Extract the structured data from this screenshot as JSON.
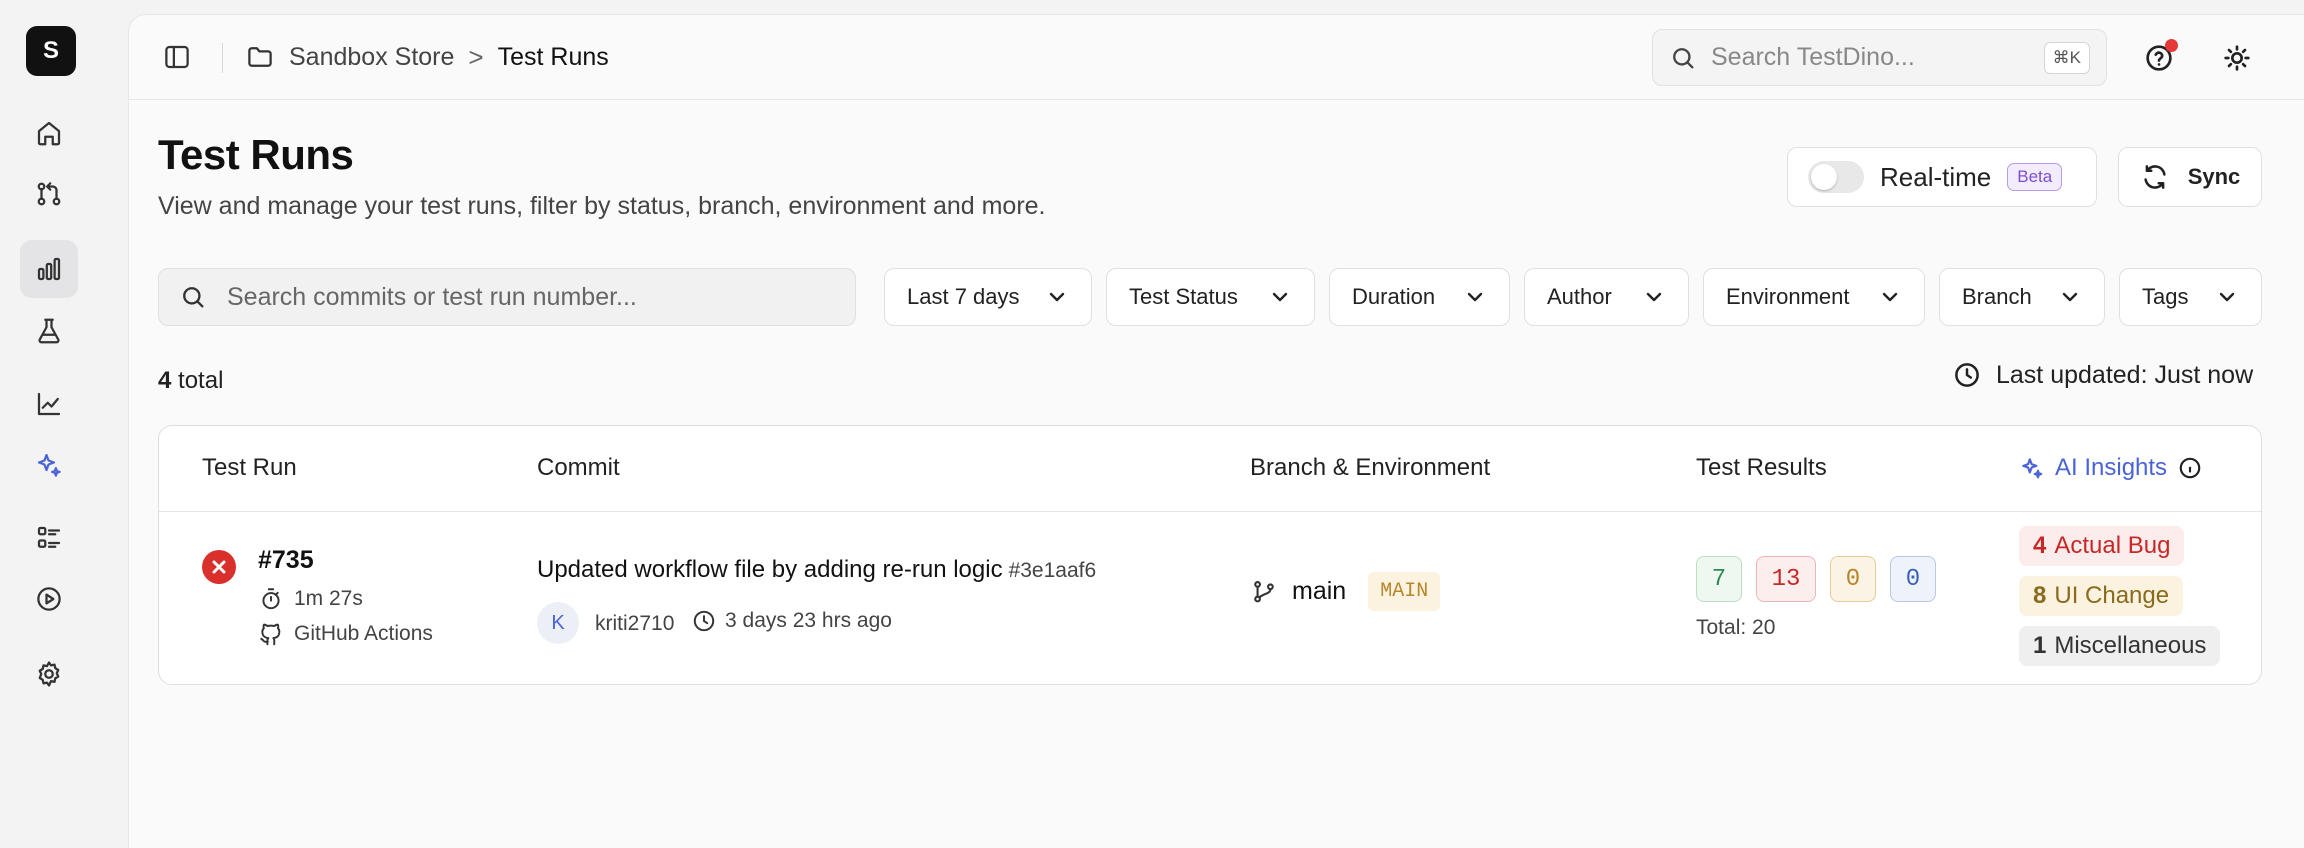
{
  "app": {
    "logo_letter": "S"
  },
  "breadcrumb": {
    "project": "Sandbox Store",
    "separator": ">",
    "current": "Test Runs"
  },
  "header": {
    "search_placeholder": "Search TestDino...",
    "search_shortcut": "⌘K",
    "notification_color": "#e53935"
  },
  "page": {
    "title": "Test Runs",
    "subtitle": "View and manage your test runs, filter by status, branch, environment and more."
  },
  "realtime": {
    "label": "Real-time",
    "badge": "Beta",
    "enabled": false
  },
  "sync": {
    "label": "Sync"
  },
  "filters": {
    "search_placeholder": "Search commits or test run number...",
    "date_range": "Last 7 days",
    "status": "Test Status",
    "duration": "Duration",
    "author": "Author",
    "environment": "Environment",
    "branch": "Branch",
    "tags": "Tags"
  },
  "summary": {
    "total_count": "4",
    "total_label": "total",
    "last_updated": "Last updated: Just now"
  },
  "table": {
    "columns": {
      "test_run": "Test Run",
      "commit": "Commit",
      "branch_env": "Branch & Environment",
      "results": "Test Results",
      "ai_insights": "AI Insights"
    },
    "rows": [
      {
        "status": "failed",
        "run_id": "#735",
        "duration": "1m 27s",
        "ci": "GitHub Actions",
        "commit_message": "Updated workflow file by adding re-run logic",
        "commit_hash": "#3e1aaf6",
        "author_initial": "K",
        "author": "kriti2710",
        "time_ago": "3 days 23 hrs ago",
        "branch": "main",
        "environment": "MAIN",
        "passed": "7",
        "failed": "13",
        "flaky": "0",
        "skipped": "0",
        "total": "Total: 20",
        "insights": {
          "actual_bug_count": "4",
          "actual_bug_label": "Actual Bug",
          "ui_change_count": "8",
          "ui_change_label": "UI Change",
          "misc_count": "1",
          "misc_label": "Miscellaneous"
        }
      }
    ]
  },
  "colors": {
    "accent": "#4a63d8",
    "fail": "#d9302c",
    "pass": "#2e8b57",
    "flaky": "#b8862a",
    "skip": "#3a63b8"
  }
}
